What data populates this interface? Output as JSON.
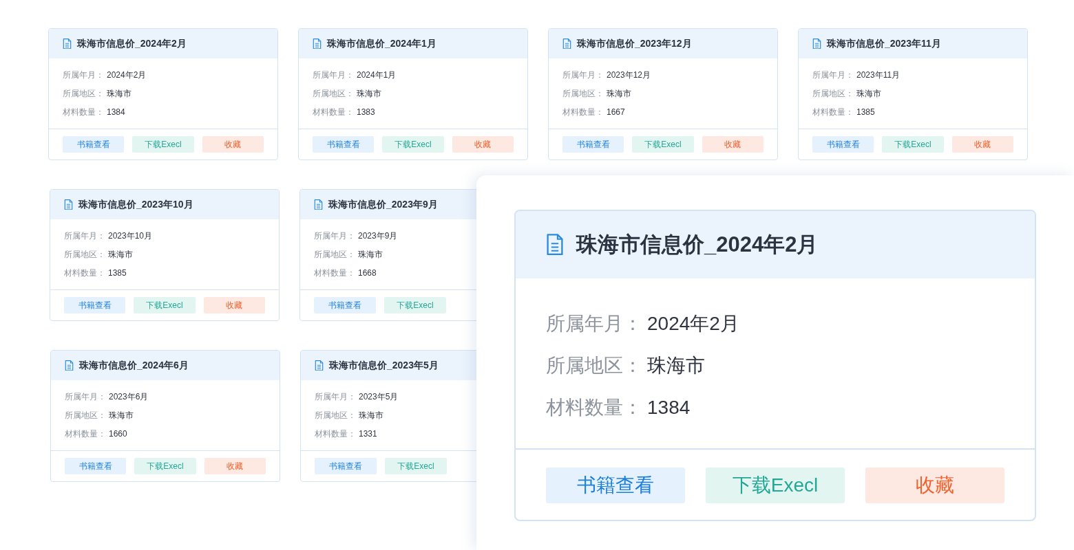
{
  "cards": [
    {
      "title": "珠海市信息价_2024年2月",
      "fields": [
        {
          "label": "所属年月：",
          "value": "2024年2月"
        },
        {
          "label": "所属地区：",
          "value": "珠海市"
        },
        {
          "label": "材料数量：",
          "value": "1384"
        }
      ],
      "buttons": [
        {
          "label": "书籍查看",
          "kind": "view"
        },
        {
          "label": "下载Execl",
          "kind": "download"
        },
        {
          "label": "收藏",
          "kind": "favorite"
        }
      ]
    },
    {
      "title": "珠海市信息价_2024年1月",
      "fields": [
        {
          "label": "所属年月：",
          "value": "2024年1月"
        },
        {
          "label": "所属地区：",
          "value": "珠海市"
        },
        {
          "label": "材料数量：",
          "value": "1383"
        }
      ],
      "buttons": [
        {
          "label": "书籍查看",
          "kind": "view"
        },
        {
          "label": "下载Execl",
          "kind": "download"
        },
        {
          "label": "收藏",
          "kind": "favorite"
        }
      ]
    },
    {
      "title": "珠海市信息价_2023年12月",
      "fields": [
        {
          "label": "所属年月：",
          "value": "2023年12月"
        },
        {
          "label": "所属地区：",
          "value": "珠海市"
        },
        {
          "label": "材料数量：",
          "value": "1667"
        }
      ],
      "buttons": [
        {
          "label": "书籍查看",
          "kind": "view"
        },
        {
          "label": "下载Execl",
          "kind": "download"
        },
        {
          "label": "收藏",
          "kind": "favorite"
        }
      ]
    },
    {
      "title": "珠海市信息价_2023年11月",
      "fields": [
        {
          "label": "所属年月：",
          "value": "2023年11月"
        },
        {
          "label": "所属地区：",
          "value": "珠海市"
        },
        {
          "label": "材料数量：",
          "value": "1385"
        }
      ],
      "buttons": [
        {
          "label": "书籍查看",
          "kind": "view"
        },
        {
          "label": "下载Execl",
          "kind": "download"
        },
        {
          "label": "收藏",
          "kind": "favorite"
        }
      ]
    },
    {
      "title": "珠海市信息价_2023年10月",
      "fields": [
        {
          "label": "所属年月：",
          "value": "2023年10月"
        },
        {
          "label": "所属地区：",
          "value": "珠海市"
        },
        {
          "label": "材料数量：",
          "value": "1385"
        }
      ],
      "buttons": [
        {
          "label": "书籍查看",
          "kind": "view"
        },
        {
          "label": "下载Execl",
          "kind": "download"
        },
        {
          "label": "收藏",
          "kind": "favorite"
        }
      ]
    },
    {
      "title": "珠海市信息价_2023年9月",
      "fields": [
        {
          "label": "所属年月：",
          "value": "2023年9月"
        },
        {
          "label": "所属地区：",
          "value": "珠海市"
        },
        {
          "label": "材料数量：",
          "value": "1668"
        }
      ],
      "buttons": [
        {
          "label": "书籍查看",
          "kind": "view"
        },
        {
          "label": "下载Execl",
          "kind": "download"
        }
      ]
    },
    {
      "title": "珠海市信息价_2024年6月",
      "fields": [
        {
          "label": "所属年月：",
          "value": "2023年6月"
        },
        {
          "label": "所属地区：",
          "value": "珠海市"
        },
        {
          "label": "材料数量：",
          "value": "1660"
        }
      ],
      "buttons": [
        {
          "label": "书籍查看",
          "kind": "view"
        },
        {
          "label": "下载Execl",
          "kind": "download"
        },
        {
          "label": "收藏",
          "kind": "favorite"
        }
      ]
    },
    {
      "title": "珠海市信息价_2023年5月",
      "fields": [
        {
          "label": "所属年月：",
          "value": "2023年5月"
        },
        {
          "label": "所属地区：",
          "value": "珠海市"
        },
        {
          "label": "材料数量：",
          "value": "1331"
        }
      ],
      "buttons": [
        {
          "label": "书籍查看",
          "kind": "view"
        },
        {
          "label": "下载Execl",
          "kind": "download"
        }
      ]
    }
  ],
  "detail": {
    "title": "珠海市信息价_2024年2月",
    "fields": [
      {
        "label": "所属年月：",
        "value": "2024年2月"
      },
      {
        "label": "所属地区：",
        "value": "珠海市"
      },
      {
        "label": "材料数量：",
        "value": "1384"
      }
    ],
    "buttons": [
      {
        "label": "书籍查看",
        "kind": "view"
      },
      {
        "label": "下载Execl",
        "kind": "download"
      },
      {
        "label": "收藏",
        "kind": "favorite"
      }
    ]
  }
}
